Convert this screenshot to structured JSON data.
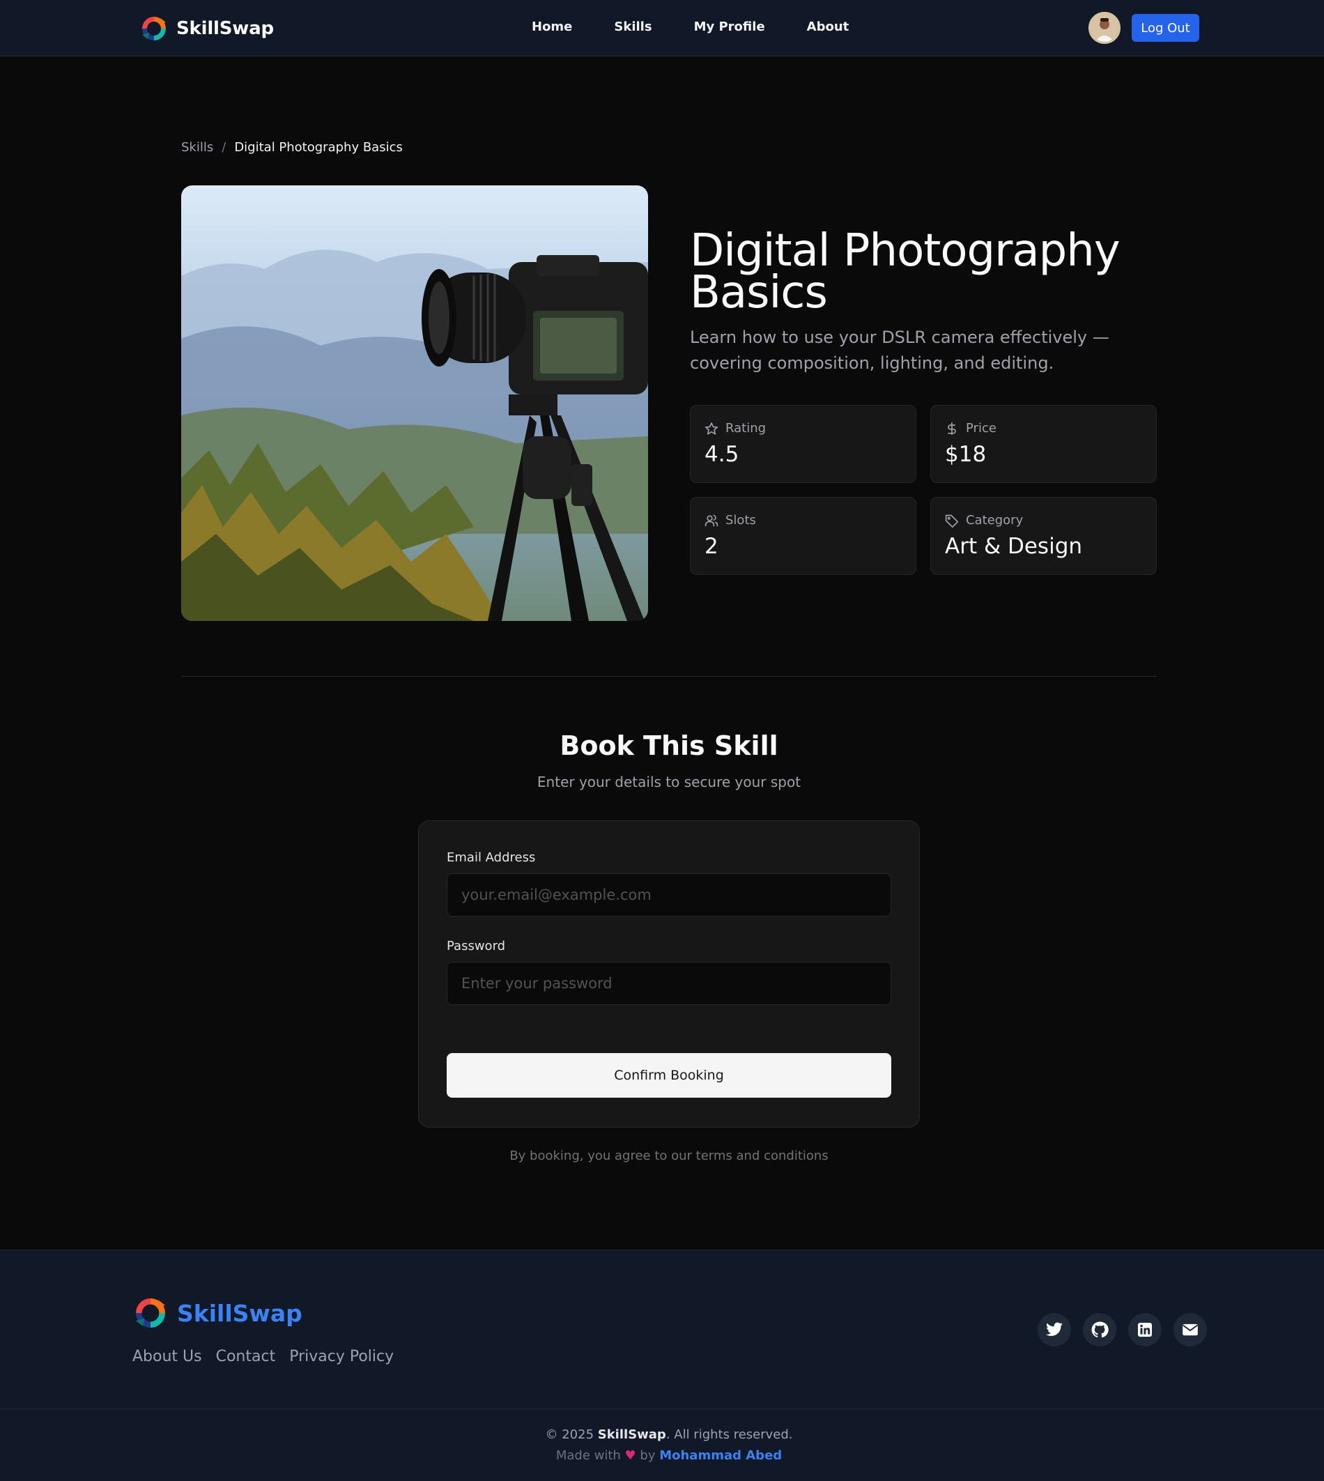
{
  "header": {
    "brand": "SkillSwap",
    "nav": [
      "Home",
      "Skills",
      "My Profile",
      "About"
    ],
    "logout_label": "Log Out"
  },
  "breadcrumb": {
    "root": "Skills",
    "separator": "/",
    "current": "Digital Photography Basics"
  },
  "skill": {
    "title": "Digital Photography Basics",
    "description": "Learn how to use your DSLR camera effectively — covering composition, lighting, and editing.",
    "stats": {
      "rating": {
        "label": "Rating",
        "value": "4.5",
        "icon": "star-icon"
      },
      "price": {
        "label": "Price",
        "value": "$18",
        "icon": "dollar-icon"
      },
      "slots": {
        "label": "Slots",
        "value": "2",
        "icon": "users-icon"
      },
      "category": {
        "label": "Category",
        "value": "Art & Design",
        "icon": "tag-icon"
      }
    }
  },
  "booking": {
    "title": "Book This Skill",
    "subtitle": "Enter your details to secure your spot",
    "email_label": "Email Address",
    "email_placeholder": "your.email@example.com",
    "email_value": "",
    "password_label": "Password",
    "password_placeholder": "Enter your password",
    "password_value": "",
    "confirm_label": "Confirm Booking",
    "terms": "By booking, you agree to our terms and conditions"
  },
  "footer": {
    "brand": "SkillSwap",
    "links": [
      "About Us",
      "Contact",
      "Privacy Policy"
    ],
    "socials": [
      "twitter-icon",
      "github-icon",
      "linkedin-icon",
      "mail-icon"
    ],
    "copyright_prefix": "© 2025 ",
    "copyright_brand": "SkillSwap",
    "copyright_suffix": ". All rights reserved.",
    "made_prefix": "Made with ",
    "made_heart": "♥",
    "made_by": " by ",
    "author": "Mohammad Abed"
  },
  "colors": {
    "accent": "#2563eb",
    "footer_brand": "#3b82f6",
    "background": "#0a0a0a",
    "nav_bg": "#111827"
  }
}
